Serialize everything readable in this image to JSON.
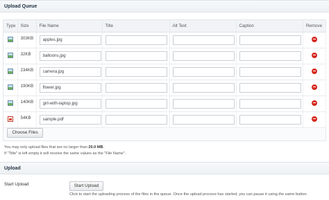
{
  "queue": {
    "title": "Upload Queue",
    "columns": [
      "Type",
      "Size",
      "File Name",
      "Title",
      "Alt Text",
      "Caption",
      "Remove"
    ],
    "rows": [
      {
        "type": "image-icon",
        "size": "303KB",
        "file_name": "apples.jpg",
        "title": "",
        "alt_text": "",
        "caption": ""
      },
      {
        "type": "image-icon",
        "size": "32KB",
        "file_name": "balloons.jpg",
        "title": "",
        "alt_text": "",
        "caption": ""
      },
      {
        "type": "image-icon",
        "size": "234KB",
        "file_name": "camera.jpg",
        "title": "",
        "alt_text": "",
        "caption": ""
      },
      {
        "type": "image-icon",
        "size": "190KB",
        "file_name": "flower.jpg",
        "title": "",
        "alt_text": "",
        "caption": ""
      },
      {
        "type": "image-icon",
        "size": "140KB",
        "file_name": "girl-with-laptop.jpg",
        "title": "",
        "alt_text": "",
        "caption": ""
      },
      {
        "type": "pdf-icon",
        "size": "54KB",
        "file_name": "sample.pdf",
        "title": "",
        "alt_text": "",
        "caption": ""
      }
    ],
    "choose_files_label": "Choose Files",
    "note_prefix": "You may only upload files that are no larger than ",
    "note_limit": "20.0 MB",
    "note_suffix": ".",
    "note2": "If \"Title\" is left empty it will receive the same values as the \"File Name\"."
  },
  "upload": {
    "title": "Upload",
    "start_label": "Start Upload",
    "button_label": "Start Upload",
    "description": "Click to start the uploading process of the files in the queue. Once the upload process has started, you can pause it using the same button."
  },
  "colors": {
    "remove": "#d72a22",
    "header_bg": "#eef1f4"
  }
}
